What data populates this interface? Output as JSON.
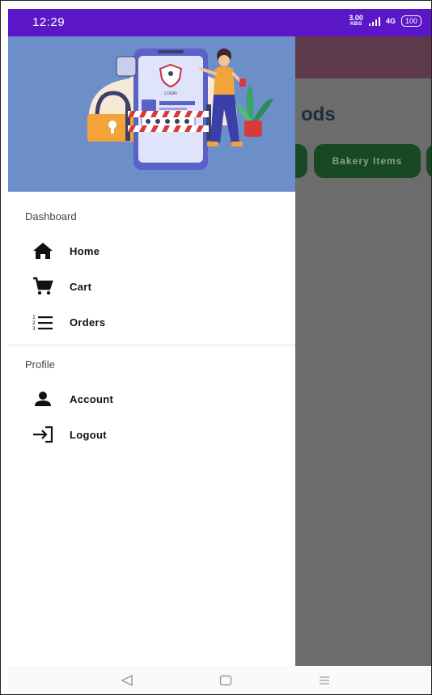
{
  "status_bar": {
    "time": "12:29",
    "net_speed_value": "3.00",
    "net_speed_unit": "KB/S",
    "network": "4G",
    "battery": "100"
  },
  "app": {
    "title_partial": "ods",
    "chips": [
      "",
      "Bakery Items",
      ""
    ]
  },
  "drawer": {
    "header_image": "login-security-illustration",
    "header_image_text": "LOGIN",
    "sections": [
      {
        "title": "Dashboard",
        "items": [
          {
            "label": "Home",
            "icon": "home-icon"
          },
          {
            "label": "Cart",
            "icon": "cart-icon"
          },
          {
            "label": "Orders",
            "icon": "list-numbered-icon"
          }
        ]
      },
      {
        "title": "Profile",
        "items": [
          {
            "label": "Account",
            "icon": "person-icon"
          },
          {
            "label": "Logout",
            "icon": "logout-icon"
          }
        ]
      }
    ]
  },
  "colors": {
    "status_bar": "#5b17c7",
    "drawer_header": "#6d8fc9",
    "scrim": "#6c6c6c",
    "chip": "#174a22"
  },
  "navbar": {
    "back": "back-triangle-icon",
    "home": "home-square-icon",
    "menu": "menu-lines-icon"
  }
}
